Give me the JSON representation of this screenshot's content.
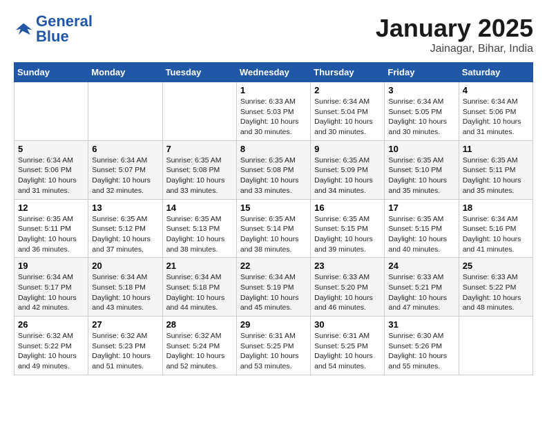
{
  "logo": {
    "text_general": "General",
    "text_blue": "Blue"
  },
  "header": {
    "title": "January 2025",
    "subtitle": "Jainagar, Bihar, India"
  },
  "weekdays": [
    "Sunday",
    "Monday",
    "Tuesday",
    "Wednesday",
    "Thursday",
    "Friday",
    "Saturday"
  ],
  "weeks": [
    [
      null,
      null,
      null,
      {
        "day": 1,
        "sunrise": "6:33 AM",
        "sunset": "5:03 PM",
        "daylight": "10 hours and 30 minutes."
      },
      {
        "day": 2,
        "sunrise": "6:34 AM",
        "sunset": "5:04 PM",
        "daylight": "10 hours and 30 minutes."
      },
      {
        "day": 3,
        "sunrise": "6:34 AM",
        "sunset": "5:05 PM",
        "daylight": "10 hours and 30 minutes."
      },
      {
        "day": 4,
        "sunrise": "6:34 AM",
        "sunset": "5:06 PM",
        "daylight": "10 hours and 31 minutes."
      }
    ],
    [
      {
        "day": 5,
        "sunrise": "6:34 AM",
        "sunset": "5:06 PM",
        "daylight": "10 hours and 31 minutes."
      },
      {
        "day": 6,
        "sunrise": "6:34 AM",
        "sunset": "5:07 PM",
        "daylight": "10 hours and 32 minutes."
      },
      {
        "day": 7,
        "sunrise": "6:35 AM",
        "sunset": "5:08 PM",
        "daylight": "10 hours and 33 minutes."
      },
      {
        "day": 8,
        "sunrise": "6:35 AM",
        "sunset": "5:08 PM",
        "daylight": "10 hours and 33 minutes."
      },
      {
        "day": 9,
        "sunrise": "6:35 AM",
        "sunset": "5:09 PM",
        "daylight": "10 hours and 34 minutes."
      },
      {
        "day": 10,
        "sunrise": "6:35 AM",
        "sunset": "5:10 PM",
        "daylight": "10 hours and 35 minutes."
      },
      {
        "day": 11,
        "sunrise": "6:35 AM",
        "sunset": "5:11 PM",
        "daylight": "10 hours and 35 minutes."
      }
    ],
    [
      {
        "day": 12,
        "sunrise": "6:35 AM",
        "sunset": "5:11 PM",
        "daylight": "10 hours and 36 minutes."
      },
      {
        "day": 13,
        "sunrise": "6:35 AM",
        "sunset": "5:12 PM",
        "daylight": "10 hours and 37 minutes."
      },
      {
        "day": 14,
        "sunrise": "6:35 AM",
        "sunset": "5:13 PM",
        "daylight": "10 hours and 38 minutes."
      },
      {
        "day": 15,
        "sunrise": "6:35 AM",
        "sunset": "5:14 PM",
        "daylight": "10 hours and 38 minutes."
      },
      {
        "day": 16,
        "sunrise": "6:35 AM",
        "sunset": "5:15 PM",
        "daylight": "10 hours and 39 minutes."
      },
      {
        "day": 17,
        "sunrise": "6:35 AM",
        "sunset": "5:15 PM",
        "daylight": "10 hours and 40 minutes."
      },
      {
        "day": 18,
        "sunrise": "6:34 AM",
        "sunset": "5:16 PM",
        "daylight": "10 hours and 41 minutes."
      }
    ],
    [
      {
        "day": 19,
        "sunrise": "6:34 AM",
        "sunset": "5:17 PM",
        "daylight": "10 hours and 42 minutes."
      },
      {
        "day": 20,
        "sunrise": "6:34 AM",
        "sunset": "5:18 PM",
        "daylight": "10 hours and 43 minutes."
      },
      {
        "day": 21,
        "sunrise": "6:34 AM",
        "sunset": "5:18 PM",
        "daylight": "10 hours and 44 minutes."
      },
      {
        "day": 22,
        "sunrise": "6:34 AM",
        "sunset": "5:19 PM",
        "daylight": "10 hours and 45 minutes."
      },
      {
        "day": 23,
        "sunrise": "6:33 AM",
        "sunset": "5:20 PM",
        "daylight": "10 hours and 46 minutes."
      },
      {
        "day": 24,
        "sunrise": "6:33 AM",
        "sunset": "5:21 PM",
        "daylight": "10 hours and 47 minutes."
      },
      {
        "day": 25,
        "sunrise": "6:33 AM",
        "sunset": "5:22 PM",
        "daylight": "10 hours and 48 minutes."
      }
    ],
    [
      {
        "day": 26,
        "sunrise": "6:32 AM",
        "sunset": "5:22 PM",
        "daylight": "10 hours and 49 minutes."
      },
      {
        "day": 27,
        "sunrise": "6:32 AM",
        "sunset": "5:23 PM",
        "daylight": "10 hours and 51 minutes."
      },
      {
        "day": 28,
        "sunrise": "6:32 AM",
        "sunset": "5:24 PM",
        "daylight": "10 hours and 52 minutes."
      },
      {
        "day": 29,
        "sunrise": "6:31 AM",
        "sunset": "5:25 PM",
        "daylight": "10 hours and 53 minutes."
      },
      {
        "day": 30,
        "sunrise": "6:31 AM",
        "sunset": "5:25 PM",
        "daylight": "10 hours and 54 minutes."
      },
      {
        "day": 31,
        "sunrise": "6:30 AM",
        "sunset": "5:26 PM",
        "daylight": "10 hours and 55 minutes."
      },
      null
    ]
  ],
  "labels": {
    "sunrise_prefix": "Sunrise: ",
    "sunset_prefix": "Sunset: ",
    "daylight_prefix": "Daylight: "
  }
}
